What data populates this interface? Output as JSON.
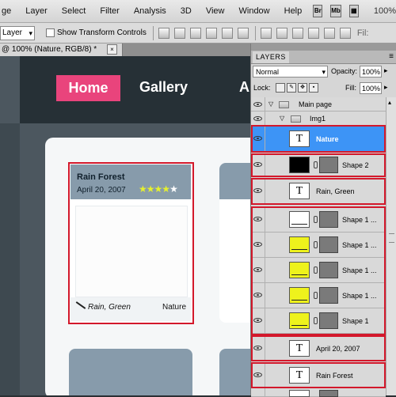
{
  "menubar": {
    "items": [
      "ge",
      "Layer",
      "Select",
      "Filter",
      "Analysis",
      "3D",
      "View",
      "Window",
      "Help"
    ],
    "icons": [
      "bridge-icon",
      "mini-bridge-icon",
      "arrange-documents-icon"
    ],
    "zoom": "100%"
  },
  "options": {
    "auto_select_value": "Layer",
    "show_transform_controls": "Show Transform Controls",
    "fill_label": "Fil:"
  },
  "document": {
    "tab_title": "@ 100% (Nature, RGB/8) *",
    "close": "×"
  },
  "site": {
    "nav": {
      "home": "Home",
      "gallery": "Gallery",
      "partial": "A"
    },
    "card": {
      "title": "Rain Forest",
      "date": "April 20, 2007",
      "rating": 4,
      "rating_max": 5,
      "caption": "Rain, Green",
      "category": "Nature"
    },
    "colors": {
      "accent": "#e9447c",
      "header": "#263036",
      "card_head": "#879bab",
      "highlight": "#d3182b"
    }
  },
  "layers_panel": {
    "tab": "LAYERS",
    "blend_mode": "Normal",
    "opacity_label": "Opacity:",
    "opacity_value": "100%",
    "lock_label": "Lock:",
    "fill_label": "Fill:",
    "fill_value": "100%",
    "groups": [
      {
        "name": "Main page"
      },
      {
        "name": "Img1"
      }
    ],
    "layers": [
      {
        "name": "Nature",
        "kind": "text",
        "selected": true
      },
      {
        "name": "Shape 2",
        "kind": "shape-black"
      },
      {
        "name": "Rain, Green",
        "kind": "text"
      },
      {
        "name": "Shape 1 ...",
        "kind": "shape-white"
      },
      {
        "name": "Shape 1 ...",
        "kind": "shape-yellow"
      },
      {
        "name": "Shape 1 ...",
        "kind": "shape-yellow"
      },
      {
        "name": "Shape 1 ...",
        "kind": "shape-yellow"
      },
      {
        "name": "Shape 1",
        "kind": "shape-yellow"
      },
      {
        "name": "April 20, 2007",
        "kind": "text"
      },
      {
        "name": "Rain Forest",
        "kind": "text"
      }
    ]
  }
}
